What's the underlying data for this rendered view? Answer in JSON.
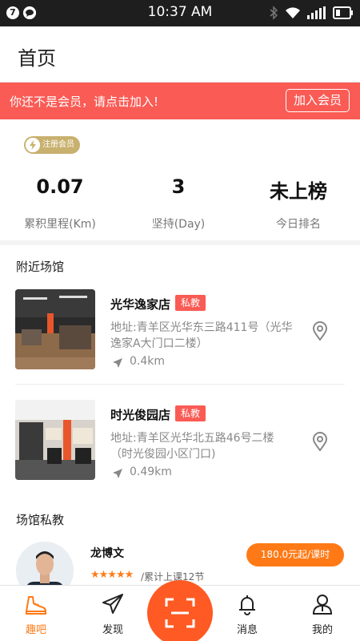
{
  "status_bar": {
    "time": "10:37 AM",
    "notification_count": "7"
  },
  "header": {
    "title": "首页"
  },
  "banner": {
    "text": "你还不是会员，请点击加入!",
    "button": "加入会员"
  },
  "badge": {
    "label": "注册会员"
  },
  "stats": [
    {
      "value": "0.07",
      "label": "累积里程(Km)"
    },
    {
      "value": "3",
      "label": "坚持(Day)"
    },
    {
      "value": "未上榜",
      "label": "今日排名"
    }
  ],
  "nearby": {
    "title": "附近场馆",
    "venues": [
      {
        "name": "光华逸家店",
        "tag": "私教",
        "address": "地址:青羊区光华东三路411号（光华逸家A大门口二楼）",
        "distance": "0.4km"
      },
      {
        "name": "时光俊园店",
        "tag": "私教",
        "address": "地址:青羊区光华北五路46号二楼（时光俊园小区门口)",
        "distance": "0.49km"
      }
    ]
  },
  "coaches": {
    "title": "场馆私教",
    "items": [
      {
        "name": "龙博文",
        "stars": "★★★★★",
        "rating": 5,
        "sessions": "/累计上课12节",
        "price": "180.0元起/课时"
      }
    ]
  },
  "tabbar": {
    "tabs": [
      {
        "label": "趣吧",
        "icon": "sneaker-icon",
        "active": true
      },
      {
        "label": "发现",
        "icon": "paper-plane-icon"
      },
      {
        "label": "消息",
        "icon": "bell-icon"
      },
      {
        "label": "我的",
        "icon": "user-icon"
      }
    ],
    "scan_icon": "scan-icon"
  },
  "colors": {
    "accent_red": "#fa5b55",
    "accent_orange": "#ff7a16",
    "scan": "#ff5a24"
  }
}
